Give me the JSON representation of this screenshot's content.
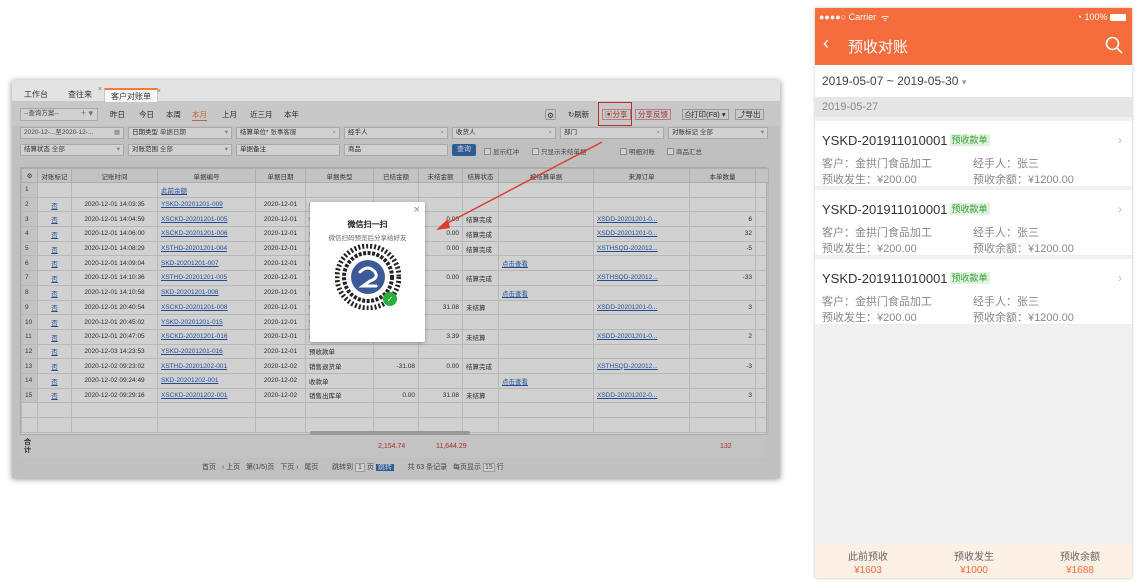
{
  "desktop": {
    "tabs": [
      {
        "label": "工作台"
      },
      {
        "label": "查往来"
      },
      {
        "label": "客户对账单"
      }
    ],
    "query_scheme": "--查询方案--",
    "period_buttons": [
      "昨日",
      "今日",
      "本周",
      "本月",
      "上月",
      "近三月",
      "本年"
    ],
    "action_buttons": {
      "refresh": "刷新",
      "share": "分享",
      "share_feedback": "分享反馈",
      "print": "打印(F8)",
      "export": "导出"
    },
    "filters": {
      "date_range": "2020-12-...至2020-12-...",
      "date_type_label": "日期类型",
      "date_type_value": "单据日期",
      "settle_unit_label": "结算单位*",
      "settle_unit_value": "张事客服",
      "handler_label": "经手人",
      "payee_label": "收货人",
      "dept_label": "部门",
      "check_mark_label": "对账标记",
      "check_mark_value": "全部",
      "settle_status_label": "结算状态",
      "settle_status_value": "全部",
      "check_scope_label": "对账范围",
      "check_scope_value": "全部",
      "remark_label": "单据备注",
      "goods_label": "商品",
      "query_button": "查询",
      "show_red": "显示红冲",
      "only_unsettled": "只显示未结单据",
      "show_detail": "明细对账",
      "goods_summary": "商品汇总"
    },
    "columns": [
      "对账标记",
      "记账时间",
      "单据编号",
      "单据日期",
      "单据类型",
      "已结金额",
      "未结金额",
      "结算状态",
      "被结算单据",
      "来源订单",
      "本单数量"
    ],
    "rows": [
      {
        "n": "1",
        "mark": "",
        "time": "",
        "no": "此前余额",
        "date": "",
        "type": "",
        "settled": "",
        "unsettled": "",
        "status": "",
        "target": "",
        "source": "",
        "qty": ""
      },
      {
        "n": "2",
        "mark": "否",
        "time": "2020-12-01 14:03:35",
        "no": "YSKD-20201201-009",
        "date": "2020-12-01",
        "type": "预",
        "settled": "",
        "unsettled": "",
        "status": "",
        "target": "",
        "source": "",
        "qty": ""
      },
      {
        "n": "3",
        "mark": "否",
        "time": "2020-12-01 14:04:59",
        "no": "XSCKD-20201201-005",
        "date": "2020-12-01",
        "type": "销",
        "settled": "",
        "unsettled": "0.00",
        "status": "结算完成",
        "target": "",
        "source": "XSDD-20201201-0...",
        "qty": "6"
      },
      {
        "n": "4",
        "mark": "否",
        "time": "2020-12-01 14:06:00",
        "no": "XSCKD-20201201-006",
        "date": "2020-12-01",
        "type": "销",
        "settled": "",
        "unsettled": "0.00",
        "status": "结算完成",
        "target": "",
        "source": "XSDD-20201201-0...",
        "qty": "32"
      },
      {
        "n": "5",
        "mark": "否",
        "time": "2020-12-01 14:08:29",
        "no": "XSTHD-20201201-004",
        "date": "2020-12-01",
        "type": "销",
        "settled": "",
        "unsettled": "0.00",
        "status": "结算完成",
        "target": "",
        "source": "XSTHSQD-202012...",
        "qty": "-5"
      },
      {
        "n": "6",
        "mark": "否",
        "time": "2020-12-01 14:09:04",
        "no": "SKD-20201201-007",
        "date": "2020-12-01",
        "type": "收",
        "settled": "",
        "unsettled": "",
        "status": "",
        "target": "点击查看",
        "source": "",
        "qty": ""
      },
      {
        "n": "7",
        "mark": "否",
        "time": "2020-12-01 14:10:36",
        "no": "XSTHD-20201201-005",
        "date": "2020-12-01",
        "type": "销",
        "settled": "",
        "unsettled": "0.00",
        "status": "结算完成",
        "target": "",
        "source": "XSTHSQD-202012...",
        "qty": "-33"
      },
      {
        "n": "8",
        "mark": "否",
        "time": "2020-12-01 14:10:58",
        "no": "SKD-20201201-008",
        "date": "2020-12-01",
        "type": "收",
        "settled": "",
        "unsettled": "",
        "status": "",
        "target": "点击查看",
        "source": "",
        "qty": ""
      },
      {
        "n": "9",
        "mark": "否",
        "time": "2020-12-01 20:40:54",
        "no": "XSCKD-20201201-008",
        "date": "2020-12-01",
        "type": "销",
        "settled": "",
        "unsettled": "31.08",
        "status": "未结算",
        "target": "",
        "source": "XSDD-20201201-0...",
        "qty": "3"
      },
      {
        "n": "10",
        "mark": "否",
        "time": "2020-12-01 20:45:02",
        "no": "YSKD-20201201-015",
        "date": "2020-12-01",
        "type": "预",
        "settled": "",
        "unsettled": "",
        "status": "",
        "target": "",
        "source": "",
        "qty": ""
      },
      {
        "n": "11",
        "mark": "否",
        "time": "2020-12-01 20:47:05",
        "no": "XSCKD-20201201-016",
        "date": "2020-12-01",
        "type": "销",
        "settled": "",
        "unsettled": "3.39",
        "status": "未结算",
        "target": "",
        "source": "XSDD-20201201-0...",
        "qty": "2"
      },
      {
        "n": "12",
        "mark": "否",
        "time": "2020-12-03 14:23:53",
        "no": "YSKD-20201201-016",
        "date": "2020-12-01",
        "type": "预收款单",
        "settled": "",
        "unsettled": "",
        "status": "",
        "target": "",
        "source": "",
        "qty": ""
      },
      {
        "n": "13",
        "mark": "否",
        "time": "2020-12-02 09:23:02",
        "no": "XSTHD-20201202-001",
        "date": "2020-12-02",
        "type": "销售退货单",
        "settled": "-31.08",
        "unsettled": "0.00",
        "status": "结算完成",
        "target": "",
        "source": "XSTHSQD-202012...",
        "qty": "-3"
      },
      {
        "n": "14",
        "mark": "否",
        "time": "2020-12-02 09:24:49",
        "no": "SKD-20201202-001",
        "date": "2020-12-02",
        "type": "收款单",
        "settled": "",
        "unsettled": "",
        "status": "",
        "target": "点击查看",
        "source": "",
        "qty": ""
      },
      {
        "n": "15",
        "mark": "否",
        "time": "2020-12-02 09:29:16",
        "no": "XSCKD-20201202-001",
        "date": "2020-12-02",
        "type": "销售出库单",
        "settled": "0.00",
        "unsettled": "31.08",
        "status": "未结算",
        "target": "",
        "source": "XSDD-20201202-0...",
        "qty": "3"
      }
    ],
    "totals": {
      "label": "合计",
      "settled": "2,154.74",
      "unsettled": "11,644.29",
      "qty": "132"
    },
    "pager": {
      "first": "首页",
      "prev": "上页",
      "page_prefix": "第",
      "page": "(1/5)",
      "page_suffix": "页",
      "next": "下页",
      "last": "尾页",
      "jump": "跳转到",
      "jump_page": "1",
      "page_unit": "页",
      "jump_button": "跳转",
      "total_prefix": "共",
      "total": "63",
      "total_suffix": "条记录",
      "per_page_prefix": "每页显示",
      "per_page": "15",
      "per_page_suffix": "行"
    },
    "qr_modal": {
      "title": "微信扫一扫",
      "subtitle": "微信扫码预览后分享给好友",
      "close": "×"
    }
  },
  "mobile": {
    "status_bar": {
      "carrier": "●●●●○ Carrier",
      "battery": "100%"
    },
    "nav_title": "预收对账",
    "date_range": {
      "start": "2019-05-07",
      "sep": "~",
      "end": "2019-05-30"
    },
    "section_date": "2019-05-27",
    "cards": [
      {
        "id": "YSKD-201911010001",
        "tag": "预收款单",
        "customer": "客户：金拱门食品加工",
        "handler": "经手人：张三",
        "occur": "预收发生：¥200.00",
        "balance": "预收余额：¥1200.00"
      },
      {
        "id": "YSKD-201911010001",
        "tag": "预收款单",
        "customer": "客户：金拱门食品加工",
        "handler": "经手人：张三",
        "occur": "预收发生：¥200.00",
        "balance": "预收余额：¥1200.00"
      },
      {
        "id": "YSKD-201911010001",
        "tag": "预收款单",
        "customer": "客户：金拱门食品加工",
        "handler": "经手人：张三",
        "occur": "预收发生：¥200.00",
        "balance": "预收余额：¥1200.00"
      }
    ],
    "footer": [
      {
        "label": "此前预收",
        "value": "¥1603"
      },
      {
        "label": "预收发生",
        "value": "¥1000"
      },
      {
        "label": "预收余额",
        "value": "¥1688"
      }
    ]
  },
  "colors": {
    "accent": "#f56c3d",
    "link": "#2a5fb5",
    "highlight_box": "#e03b30",
    "tag_green": "#3a9d3a"
  }
}
